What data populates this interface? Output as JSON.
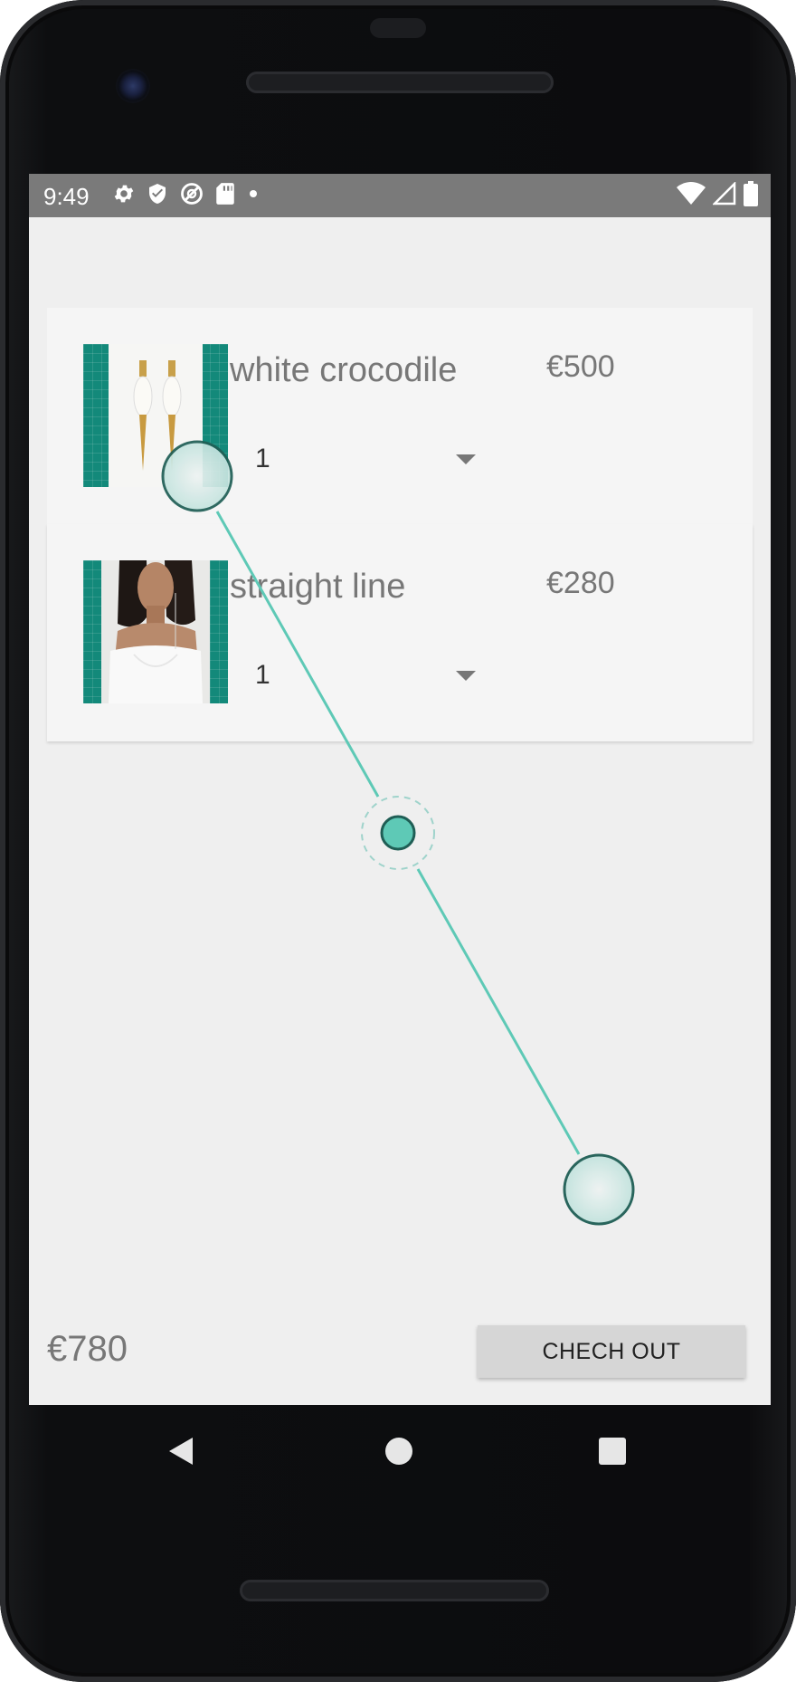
{
  "status_bar": {
    "time": "9:49",
    "left_icons": [
      "gear-icon",
      "shield-icon",
      "circle-slash-icon",
      "sd-card-icon",
      "dot-icon"
    ],
    "right_icons": [
      "wifi-icon",
      "signal-icon",
      "battery-icon"
    ]
  },
  "cart": {
    "items": [
      {
        "name": "white crocodile",
        "price": "€500",
        "quantity": "1",
        "image": "earrings-image"
      },
      {
        "name": "straight line",
        "price": "€280",
        "quantity": "1",
        "image": "model-image"
      }
    ],
    "total": "€780",
    "checkout_label": "CHECH OUT"
  },
  "colors": {
    "accent_teal": "#13897a",
    "status_bar": "#7a7a7a",
    "background": "#efefef",
    "gesture_line": "#5ec9b6"
  },
  "navigation": {
    "buttons": [
      "back-icon",
      "home-icon",
      "recents-icon"
    ]
  }
}
